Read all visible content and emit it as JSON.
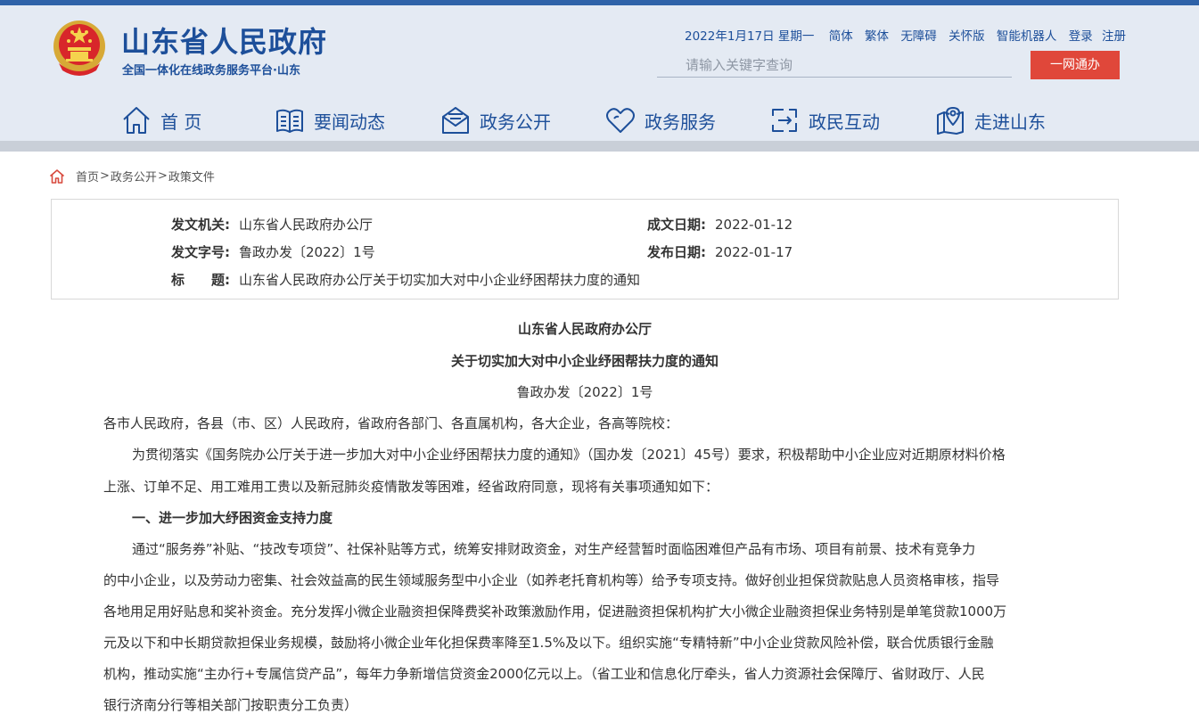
{
  "header": {
    "site_title": "山东省人民政府",
    "site_subtitle": "全国一体化在线政务服务平台·山东",
    "date": "2022年1月17日 星期一",
    "links": [
      "简体",
      "繁体",
      "无障碍",
      "关怀版",
      "智能机器人",
      "登录",
      "注册"
    ],
    "search_placeholder": "请输入关键字查询",
    "search_button": "一网通办",
    "brand_color": "#1d4f9a",
    "accent_color": "#e0473a"
  },
  "nav": [
    {
      "label": "首 页",
      "icon": "home-icon"
    },
    {
      "label": "要闻动态",
      "icon": "book-icon"
    },
    {
      "label": "政务公开",
      "icon": "envelope-icon"
    },
    {
      "label": "政务服务",
      "icon": "heart-icon"
    },
    {
      "label": "政民互动",
      "icon": "exchange-icon"
    },
    {
      "label": "走进山东",
      "icon": "map-pin-icon"
    }
  ],
  "breadcrumb": [
    "首页",
    "政务公开",
    "政策文件"
  ],
  "breadcrumb_sep": ">",
  "info": {
    "issuer_label": "发文机关:",
    "issuer": "山东省人民政府办公厅",
    "written_label": "成文日期:",
    "written_date": "2022-01-12",
    "docnum_label": "发文字号:",
    "docnum": "鲁政办发〔2022〕1号",
    "published_label": "发布日期:",
    "published_date": "2022-01-17",
    "title_label": "标　　题:",
    "title": "山东省人民政府办公厅关于切实加大对中小企业纾困帮扶力度的通知"
  },
  "doc": {
    "heading1": "山东省人民政府办公厅",
    "heading2": "关于切实加大对中小企业纾困帮扶力度的通知",
    "number": "鲁政办发〔2022〕1号",
    "lines": [
      "各市人民政府，各县（市、区）人民政府，省政府各部门、各直属机构，各大企业，各高等院校：",
      "为贯彻落实《国务院办公厅关于进一步加大对中小企业纾困帮扶力度的通知》（国办发〔2021〕45号）要求，积极帮助中小企业应对近期原材料价格",
      "上涨、订单不足、用工难用工贵以及新冠肺炎疫情散发等困难，经省政府同意，现将有关事项通知如下：",
      "一、进一步加大纾困资金支持力度",
      "通过“服务券”补贴、“技改专项贷”、社保补贴等方式，统筹安排财政资金，对生产经营暂时面临困难但产品有市场、项目有前景、技术有竞争力",
      "的中小企业，以及劳动力密集、社会效益高的民生领域服务型中小企业（如养老托育机构等）给予专项支持。做好创业担保贷款贴息人员资格审核，指导",
      "各地用足用好贴息和奖补资金。充分发挥小微企业融资担保降费奖补政策激励作用，促进融资担保机构扩大小微企业融资担保业务特别是单笔贷款1000万",
      "元及以下和中长期贷款担保业务规模，鼓励将小微企业年化担保费率降至1.5%及以下。组织实施“专精特新”中小企业贷款风险补偿，联合优质银行金融",
      "机构，推动实施“主办行+专属信贷产品”，每年力争新增信贷资金2000亿元以上。（省工业和信息化厅牵头，省人力资源社会保障厅、省财政厅、人民",
      "银行济南分行等相关部门按职责分工负责）"
    ]
  }
}
